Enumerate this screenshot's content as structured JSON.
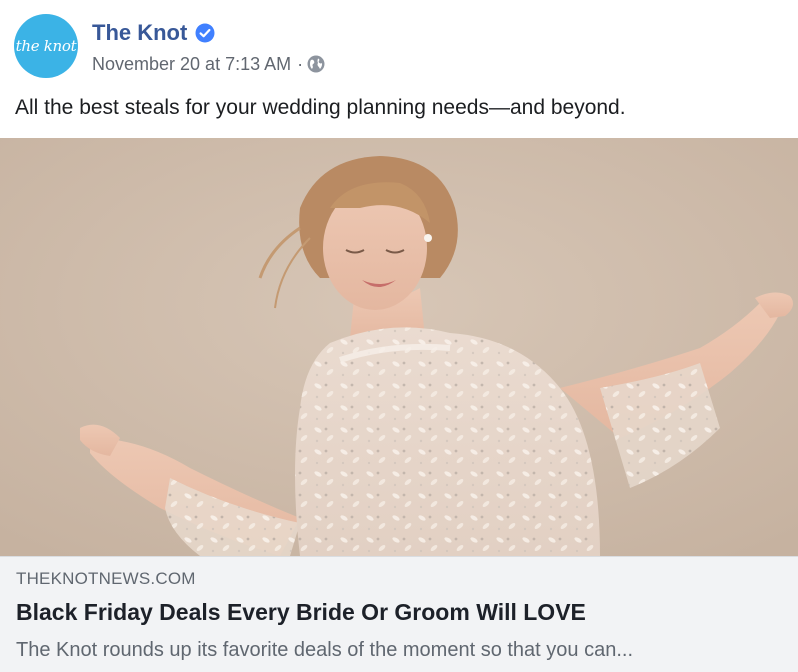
{
  "post": {
    "page_name": "The Knot",
    "avatar_text": "the knot",
    "verified_icon": "verified-badge-icon",
    "timestamp": "November 20 at 7:13 AM",
    "separator": "·",
    "audience_icon": "globe-icon",
    "message": "All the best steals for your wedding planning needs—and beyond."
  },
  "link": {
    "domain": "THEKNOTNEWS.COM",
    "headline": "Black Friday Deals Every Bride Or Groom Will LOVE",
    "description": "The Knot rounds up its favorite deals of the moment so that you can..."
  },
  "colors": {
    "page_name": "#385898",
    "avatar_bg": "#3bb3e6",
    "verified_blue": "#4080ff",
    "link_footer_bg": "#f2f3f5"
  }
}
